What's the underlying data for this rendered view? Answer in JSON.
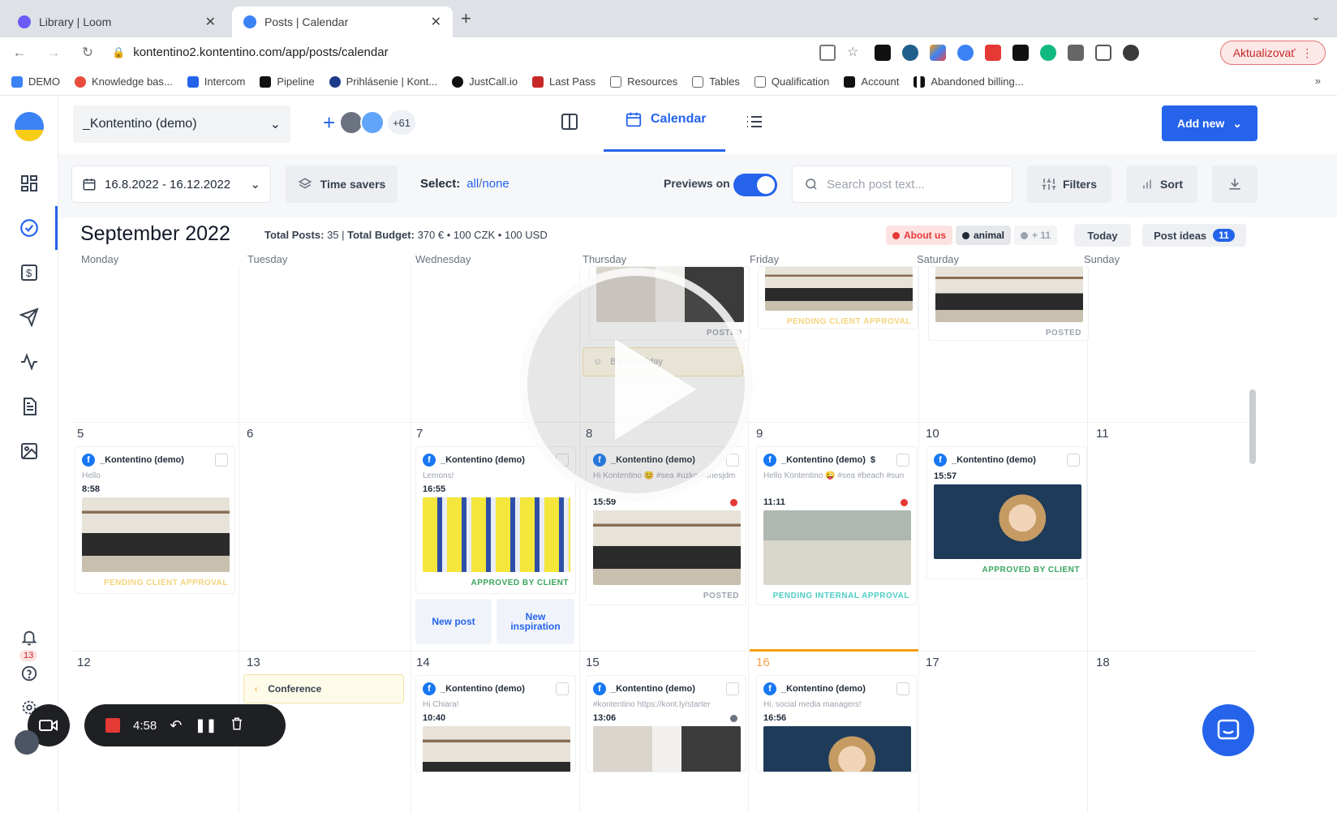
{
  "browser": {
    "tabs": [
      {
        "title": "Library | Loom",
        "active": false
      },
      {
        "title": "Posts | Calendar",
        "active": true
      }
    ],
    "url": "kontentino2.kontentino.com/app/posts/calendar",
    "update_label": "Aktualizovať",
    "bookmarks": [
      "DEMO",
      "Knowledge bas...",
      "Intercom",
      "Pipeline",
      "Prihlásenie | Kont...",
      "JustCall.io",
      "Last Pass",
      "Resources",
      "Tables",
      "Qualification",
      "Account",
      "Abandoned billing..."
    ]
  },
  "header": {
    "workspace": "_Kontentino (demo)",
    "avatars_more": "+61",
    "calendar_tab": "Calendar",
    "add_new": "Add new"
  },
  "filters": {
    "date_range": "16.8.2022 - 16.12.2022",
    "time_savers": "Time savers",
    "select_label": "Select:",
    "select_all": "all",
    "select_sep": "/",
    "select_none": "none",
    "previews_label": "Previews on",
    "search_placeholder": "Search post text...",
    "filters_label": "Filters",
    "sort_label": "Sort"
  },
  "calendar": {
    "month": "September 2022",
    "totals_prefix": "Total Posts:",
    "totals_posts": "35",
    "totals_budget_label": "Total Budget:",
    "totals_budget": "370 € • 100 CZK • 100 USD",
    "tags": [
      {
        "label": "About us",
        "color": "#e53935",
        "bg": "#fde2e2"
      },
      {
        "label": "animal",
        "color": "#1f2937",
        "bg": "#e5e7eb"
      },
      {
        "label": "+ 11",
        "color": "#9ca3af",
        "bg": "#f3f4f6"
      }
    ],
    "today_label": "Today",
    "post_ideas_label": "Post ideas",
    "post_ideas_count": "11",
    "weekdays": [
      "Monday",
      "Tuesday",
      "Wednesday",
      "Thursday",
      "Friday",
      "Saturday",
      "Sunday"
    ],
    "week2_days": [
      "5",
      "6",
      "7",
      "8",
      "9",
      "10",
      "11"
    ],
    "week3_days": [
      "12",
      "13",
      "14",
      "15",
      "16",
      "17",
      "18"
    ],
    "week1_status": {
      "thu": "POSTED",
      "fri": "PENDING CLIENT APPROVAL",
      "sat": "POSTED"
    },
    "bank_holiday": "Bank Holiday",
    "conference": "Conference",
    "new_post": "New post",
    "new_inspiration": "New inspiration",
    "posts": {
      "mon5": {
        "page": "_Kontentino (demo)",
        "text": "Hello",
        "time": "8:58",
        "status": "PENDING CLIENT APPROVAL"
      },
      "wed7": {
        "page": "_Kontentino (demo)",
        "text": "Lemons!",
        "time": "16:55",
        "status": "APPROVED BY CLIENT"
      },
      "thu8": {
        "page": "_Kontentino (demo)",
        "text": "Hi Kontentino 😊 #sea #uzko #dnesjdm",
        "time": "15:59",
        "status": "POSTED"
      },
      "fri9": {
        "page": "_Kontentino (demo)",
        "text": "Hello Kontentino 😜 #sea #beach #sun",
        "time": "11:11",
        "status": "PENDING INTERNAL APPROVAL"
      },
      "sat10": {
        "page": "_Kontentino (demo)",
        "time": "15:57",
        "status": "APPROVED BY CLIENT"
      },
      "wed14": {
        "page": "_Kontentino (demo)",
        "text": "Hi Chiara!",
        "time": "10:40"
      },
      "thu15": {
        "page": "_Kontentino (demo)",
        "text": "#kontentino https://kont.ly/starter",
        "time": "13:06"
      },
      "fri16": {
        "page": "_Kontentino (demo)",
        "text": "Hi, social media managers!",
        "time": "16:56"
      }
    },
    "status_colors": {
      "pending_client": "#f3d37a",
      "approved": "#3aa55d",
      "posted": "#9ca3af",
      "pending_internal": "#4ecdc4"
    }
  },
  "sidebar": {
    "notifications_count": "13"
  },
  "loom": {
    "timer": "4:58"
  }
}
